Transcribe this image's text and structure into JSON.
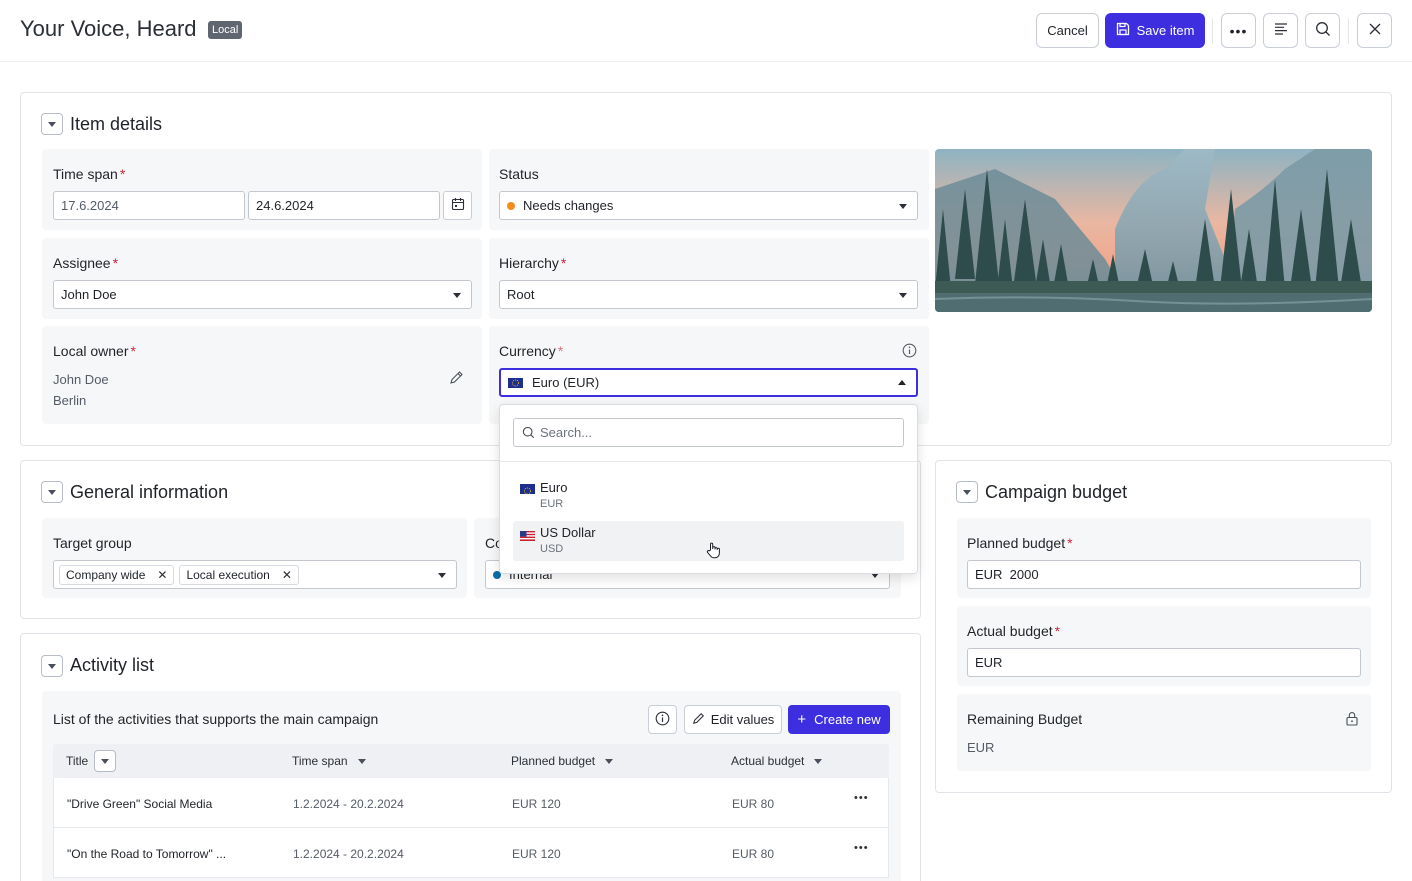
{
  "header": {
    "title": "Your Voice, Heard",
    "badge": "Local",
    "cancel_label": "Cancel",
    "save_label": "Save item"
  },
  "item_details": {
    "title": "Item details",
    "time_span": {
      "label": "Time span",
      "start": "17.6.2024",
      "end": "24.6.2024"
    },
    "status": {
      "label": "Status",
      "value": "Needs changes",
      "color": "#f28c1a"
    },
    "assignee": {
      "label": "Assignee",
      "value": "John Doe"
    },
    "hierarchy": {
      "label": "Hierarchy",
      "value": "Root"
    },
    "local_owner": {
      "label": "Local owner",
      "name": "John Doe",
      "city": "Berlin"
    },
    "currency": {
      "label": "Currency",
      "value": "Euro (EUR)"
    }
  },
  "currency_dropdown": {
    "search_placeholder": "Search...",
    "options": [
      {
        "name": "Euro",
        "code": "EUR",
        "flag": "eu-flag"
      },
      {
        "name": "US Dollar",
        "code": "USD",
        "flag": "us-flag",
        "hovered": true
      }
    ]
  },
  "general_information": {
    "title": "General information",
    "target_group": {
      "label": "Target group",
      "tags": [
        "Company wide",
        "Local execution"
      ]
    },
    "second_field": {
      "label_fragment": "Co",
      "value_fragment": "Internal",
      "color": "#0a6ea8"
    }
  },
  "campaign_budget": {
    "title": "Campaign budget",
    "planned": {
      "label": "Planned budget",
      "value": "EUR  2000"
    },
    "actual": {
      "label": "Actual budget",
      "value": "EUR"
    },
    "remaining": {
      "label": "Remaining Budget",
      "value": "EUR"
    }
  },
  "activity_list": {
    "title": "Activity list",
    "subtitle": "List of the activities that supports the main campaign",
    "edit_label": "Edit values",
    "create_label": "Create new",
    "columns": [
      "Title",
      "Time span",
      "Planned budget",
      "Actual budget"
    ],
    "rows": [
      {
        "title": "\"Drive Green\" Social Media",
        "time_span": "1.2.2024 - 20.2.2024",
        "planned": "EUR 120",
        "actual": "EUR 80"
      },
      {
        "title": "\"On the Road to Tomorrow\" ...",
        "time_span": "1.2.2024 - 20.2.2024",
        "planned": "EUR 120",
        "actual": "EUR 80"
      }
    ]
  },
  "colors": {
    "accent": "#3d2fe0",
    "required": "#d0233a",
    "focus": "#3d2fe0"
  }
}
